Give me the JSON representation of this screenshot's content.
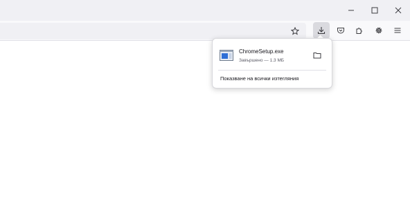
{
  "window": {
    "controls": [
      "minimize-icon",
      "maximize-icon",
      "close-icon"
    ]
  },
  "toolbar": {
    "icons": [
      "bookmark-star-icon",
      "download-icon",
      "pocket-icon",
      "extensions-icon",
      "settings-gear-icon",
      "menu-icon"
    ],
    "active": "download-icon"
  },
  "downloads_panel": {
    "items": [
      {
        "file_name": "ChromeSetup.exe",
        "status": "Завършено — 1.3 МБ",
        "icon": "executable-file-icon"
      }
    ],
    "show_all_label": "Показване на всички изтегляния"
  },
  "colors": {
    "titlebar_bg": "#f0f0f4",
    "navbar_bg": "#f9f9fb",
    "urlbar_bg": "#f0f0f4",
    "active_button_bg": "#dadadf",
    "file_icon_blue": "#2f6fd6"
  }
}
